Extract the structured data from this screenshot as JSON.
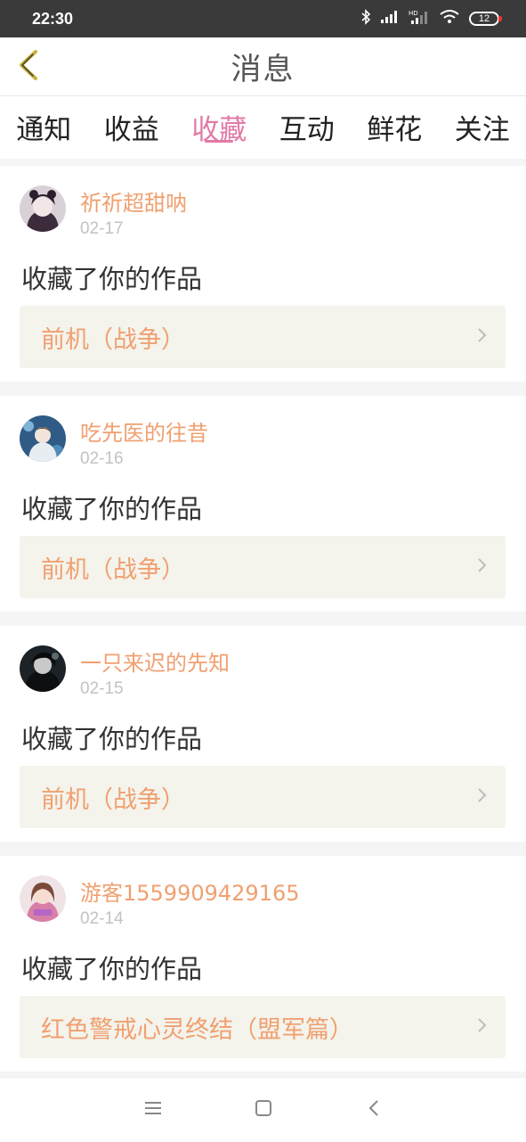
{
  "status_bar": {
    "time": "22:30",
    "battery": "12",
    "icons": [
      "bluetooth-icon",
      "signal-icon",
      "hd-signal-icon",
      "wifi-icon",
      "battery-icon"
    ]
  },
  "header": {
    "title": "消息",
    "back_icon": "chevron-left-icon"
  },
  "tabs": [
    {
      "label": "通知",
      "active": false
    },
    {
      "label": "收益",
      "active": false
    },
    {
      "label": "收藏",
      "active": true
    },
    {
      "label": "互动",
      "active": false
    },
    {
      "label": "鲜花",
      "active": false
    },
    {
      "label": "关注",
      "active": false
    }
  ],
  "messages": [
    {
      "username": "祈祈超甜呐",
      "date": "02-17",
      "action": "收藏了你的作品",
      "work": "前机（战争）"
    },
    {
      "username": "吃先医的往昔",
      "date": "02-16",
      "action": "收藏了你的作品",
      "work": "前机（战争）"
    },
    {
      "username": "一只来迟的先知",
      "date": "02-15",
      "action": "收藏了你的作品",
      "work": "前机（战争）"
    },
    {
      "username": "游客1559909429165",
      "date": "02-14",
      "action": "收藏了你的作品",
      "work": "红色警戒心灵终结（盟军篇）"
    }
  ],
  "nav_bar": {
    "icons": [
      "menu-icon",
      "home-square-icon",
      "back-triangle-icon"
    ]
  },
  "colors": {
    "accent": "#e27aa7",
    "name": "#f0a070",
    "link_bg": "#f4f3ec"
  }
}
